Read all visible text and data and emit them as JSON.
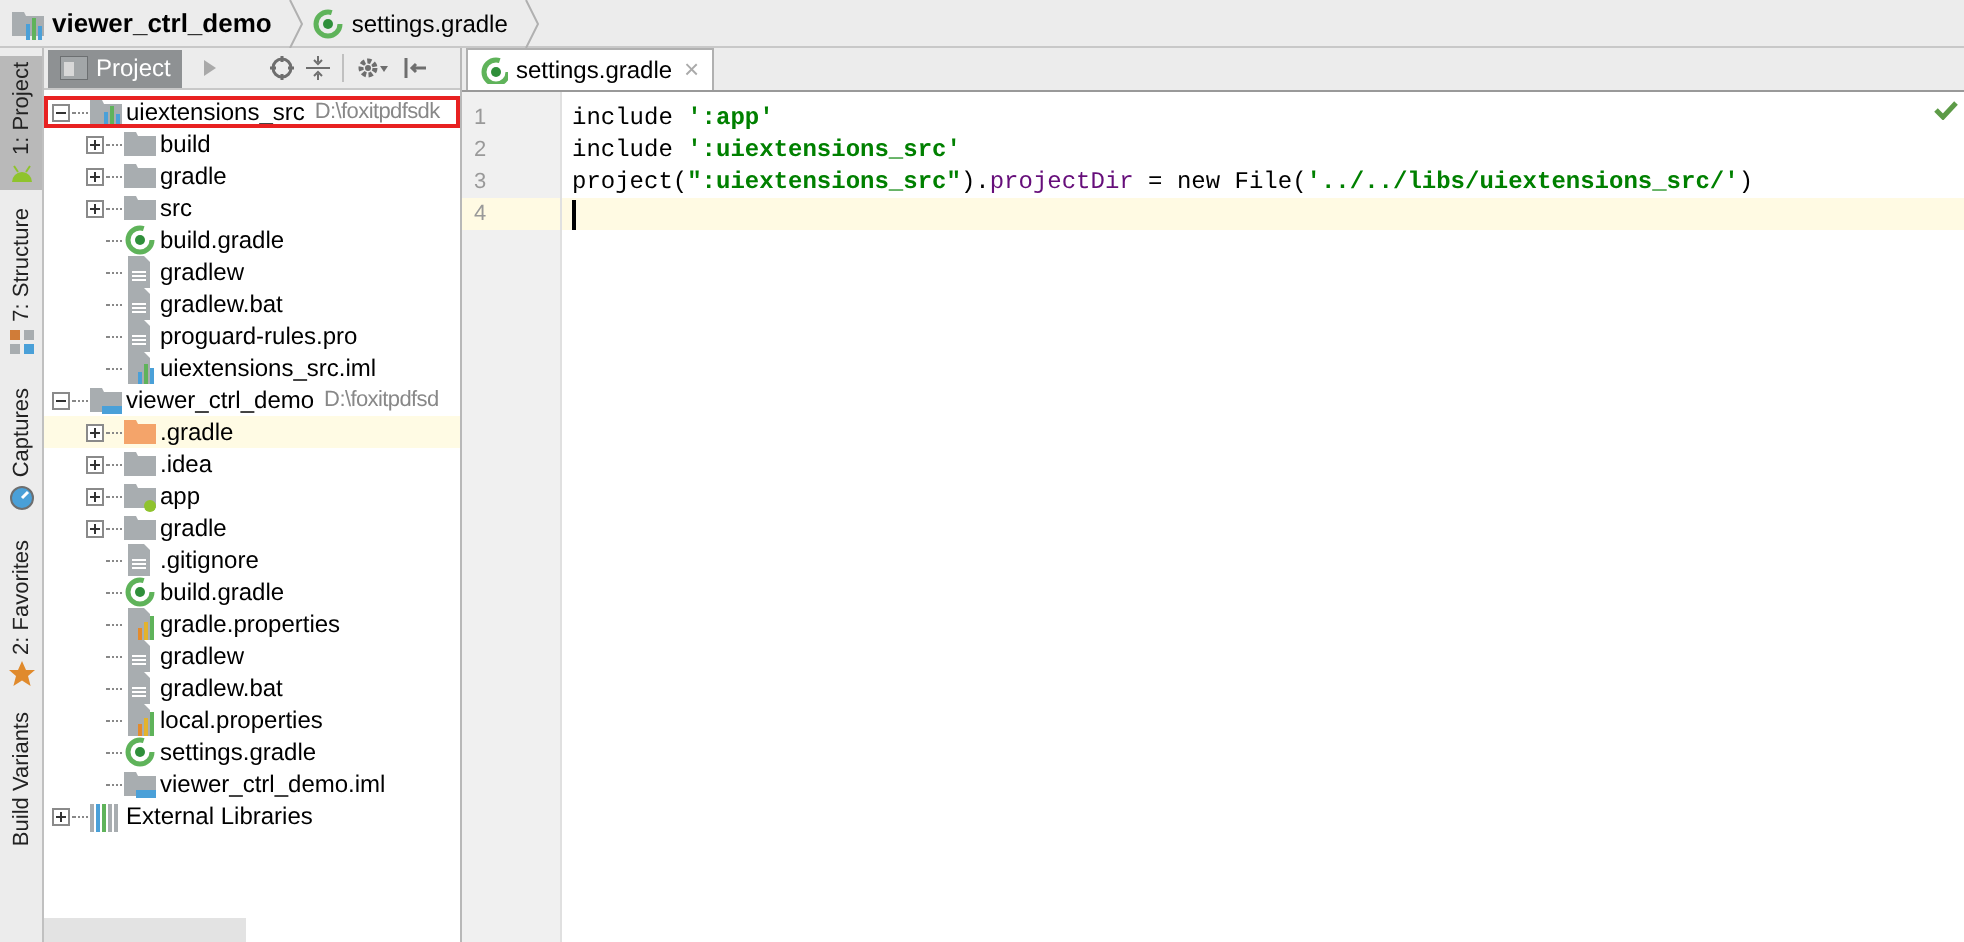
{
  "breadcrumbs": [
    {
      "label": "viewer_ctrl_demo",
      "kind": "module"
    },
    {
      "label": "settings.gradle",
      "kind": "gradle"
    }
  ],
  "tool_window_bar": [
    {
      "label": "1: Project",
      "kind": "android",
      "selected": true
    },
    {
      "label": "7: Structure",
      "kind": "structure",
      "selected": false
    },
    {
      "label": "Captures",
      "kind": "captures",
      "selected": false
    },
    {
      "label": "2: Favorites",
      "kind": "star",
      "selected": false
    },
    {
      "label": "Build Variants",
      "kind": "none",
      "selected": false
    }
  ],
  "project_panel": {
    "view_label": "Project",
    "tree": [
      {
        "label": "uiextensions_src",
        "path": "D:\\foxitpdfsdk",
        "kind": "module",
        "expanded": true,
        "selected": false,
        "outlined": true,
        "children": [
          {
            "label": "build",
            "kind": "folder",
            "expanded": false,
            "selected": false,
            "outlined": false
          },
          {
            "label": "gradle",
            "kind": "folder",
            "expanded": false,
            "selected": false,
            "outlined": false
          },
          {
            "label": "src",
            "kind": "folder",
            "expanded": false,
            "selected": false,
            "outlined": false
          },
          {
            "label": "build.gradle",
            "kind": "gradle",
            "selected": false,
            "outlined": false
          },
          {
            "label": "gradlew",
            "kind": "text",
            "selected": false,
            "outlined": false
          },
          {
            "label": "gradlew.bat",
            "kind": "text",
            "selected": false,
            "outlined": false
          },
          {
            "label": "proguard-rules.pro",
            "kind": "text",
            "selected": false,
            "outlined": false
          },
          {
            "label": "uiextensions_src.iml",
            "kind": "iml",
            "selected": false,
            "outlined": false
          }
        ]
      },
      {
        "label": "viewer_ctrl_demo",
        "path": "D:\\foxitpdfsd",
        "kind": "module2",
        "expanded": true,
        "selected": false,
        "outlined": false,
        "children": [
          {
            "label": ".gradle",
            "kind": "folder_orange",
            "expanded": false,
            "selected": true,
            "outlined": false
          },
          {
            "label": ".idea",
            "kind": "folder",
            "expanded": false,
            "selected": false,
            "outlined": false
          },
          {
            "label": "app",
            "kind": "folder_app",
            "expanded": false,
            "selected": false,
            "outlined": false
          },
          {
            "label": "gradle",
            "kind": "folder",
            "expanded": false,
            "selected": false,
            "outlined": false
          },
          {
            "label": ".gitignore",
            "kind": "text",
            "selected": false,
            "outlined": false
          },
          {
            "label": "build.gradle",
            "kind": "gradle",
            "selected": false,
            "outlined": false
          },
          {
            "label": "gradle.properties",
            "kind": "props",
            "selected": false,
            "outlined": false
          },
          {
            "label": "gradlew",
            "kind": "text",
            "selected": false,
            "outlined": false
          },
          {
            "label": "gradlew.bat",
            "kind": "text",
            "selected": false,
            "outlined": false
          },
          {
            "label": "local.properties",
            "kind": "props",
            "selected": false,
            "outlined": false
          },
          {
            "label": "settings.gradle",
            "kind": "gradle",
            "selected": false,
            "outlined": false
          },
          {
            "label": "viewer_ctrl_demo.iml",
            "kind": "module_iml",
            "selected": false,
            "outlined": false
          }
        ]
      },
      {
        "label": "External Libraries",
        "kind": "libs",
        "expanded": false,
        "selected": false,
        "outlined": false
      }
    ]
  },
  "editor": {
    "tabs": [
      {
        "label": "settings.gradle",
        "close": "×",
        "selected": true
      }
    ],
    "lines": [
      {
        "number": "1",
        "current": false,
        "tokens": [
          {
            "text": "include ",
            "kind": "plain"
          },
          {
            "text": "':app'",
            "kind": "string"
          }
        ]
      },
      {
        "number": "2",
        "current": false,
        "tokens": [
          {
            "text": "include ",
            "kind": "plain"
          },
          {
            "text": "':uiextensions_src'",
            "kind": "string"
          }
        ]
      },
      {
        "number": "3",
        "current": false,
        "tokens": [
          {
            "text": "project(",
            "kind": "plain"
          },
          {
            "text": "\":uiextensions_src\"",
            "kind": "string"
          },
          {
            "text": ").",
            "kind": "plain"
          },
          {
            "text": "projectDir",
            "kind": "property"
          },
          {
            "text": " = new File(",
            "kind": "plain"
          },
          {
            "text": "'../../libs/uiextensions_src/'",
            "kind": "string"
          },
          {
            "text": ")",
            "kind": "plain"
          }
        ]
      },
      {
        "number": "4",
        "current": true
      }
    ]
  }
}
